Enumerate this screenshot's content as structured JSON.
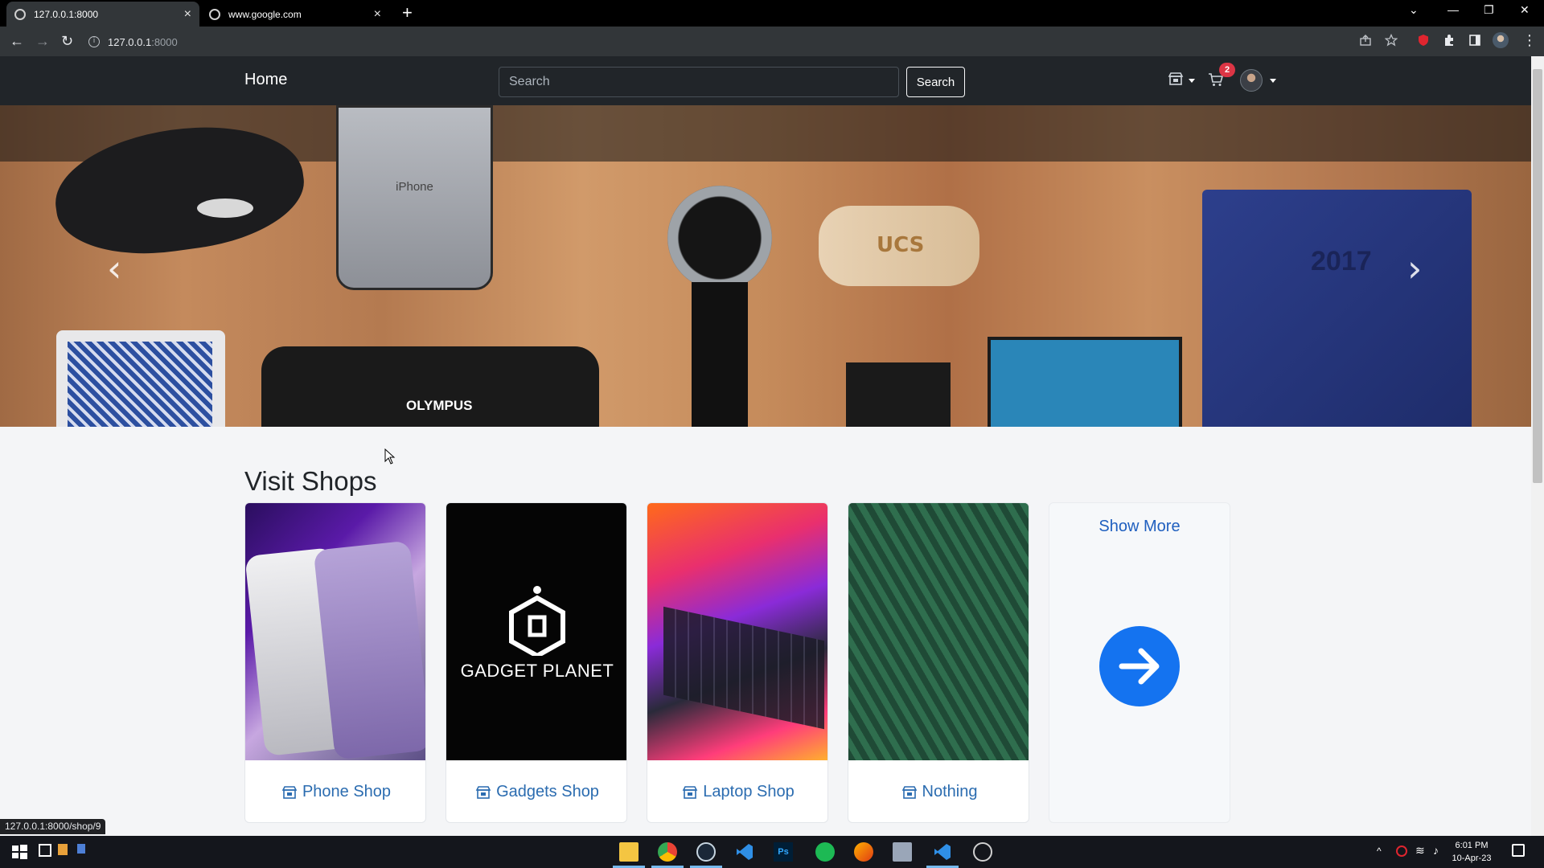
{
  "browser": {
    "tabs": [
      {
        "title": "127.0.0.1:8000",
        "active": true
      },
      {
        "title": "www.google.com",
        "active": false
      }
    ],
    "address_host": "127.0.0.1",
    "address_port": ":8000",
    "status_url": "127.0.0.1:8000/shop/9"
  },
  "navbar": {
    "brand": "Home",
    "search_placeholder": "Search",
    "search_button": "Search",
    "cart_count": "2"
  },
  "carousel": {
    "prev_glyph": "‹",
    "next_glyph": "›",
    "image_texts": [
      "iPhone",
      "OLYMPUS",
      "UCS",
      "2017"
    ]
  },
  "main": {
    "section_title": "Visit Shops",
    "shops": [
      {
        "name": "Phone Shop"
      },
      {
        "name": "Gadgets Shop",
        "logo_text": "GADGET PLANET"
      },
      {
        "name": "Laptop Shop"
      },
      {
        "name": "Nothing"
      }
    ],
    "show_more": "Show More"
  },
  "taskbar": {
    "time": "6:01 PM",
    "date": "10-Apr-23",
    "apps": [
      "file-explorer",
      "chrome",
      "steam",
      "vscode",
      "photoshop",
      "spotify",
      "firefox-dev",
      "files",
      "vscode-2",
      "obs"
    ]
  },
  "colors": {
    "navbar_bg": "#212529",
    "link_blue": "#2b6cb0",
    "arrow_circle": "#1473f0",
    "badge_red": "#dc3545"
  }
}
